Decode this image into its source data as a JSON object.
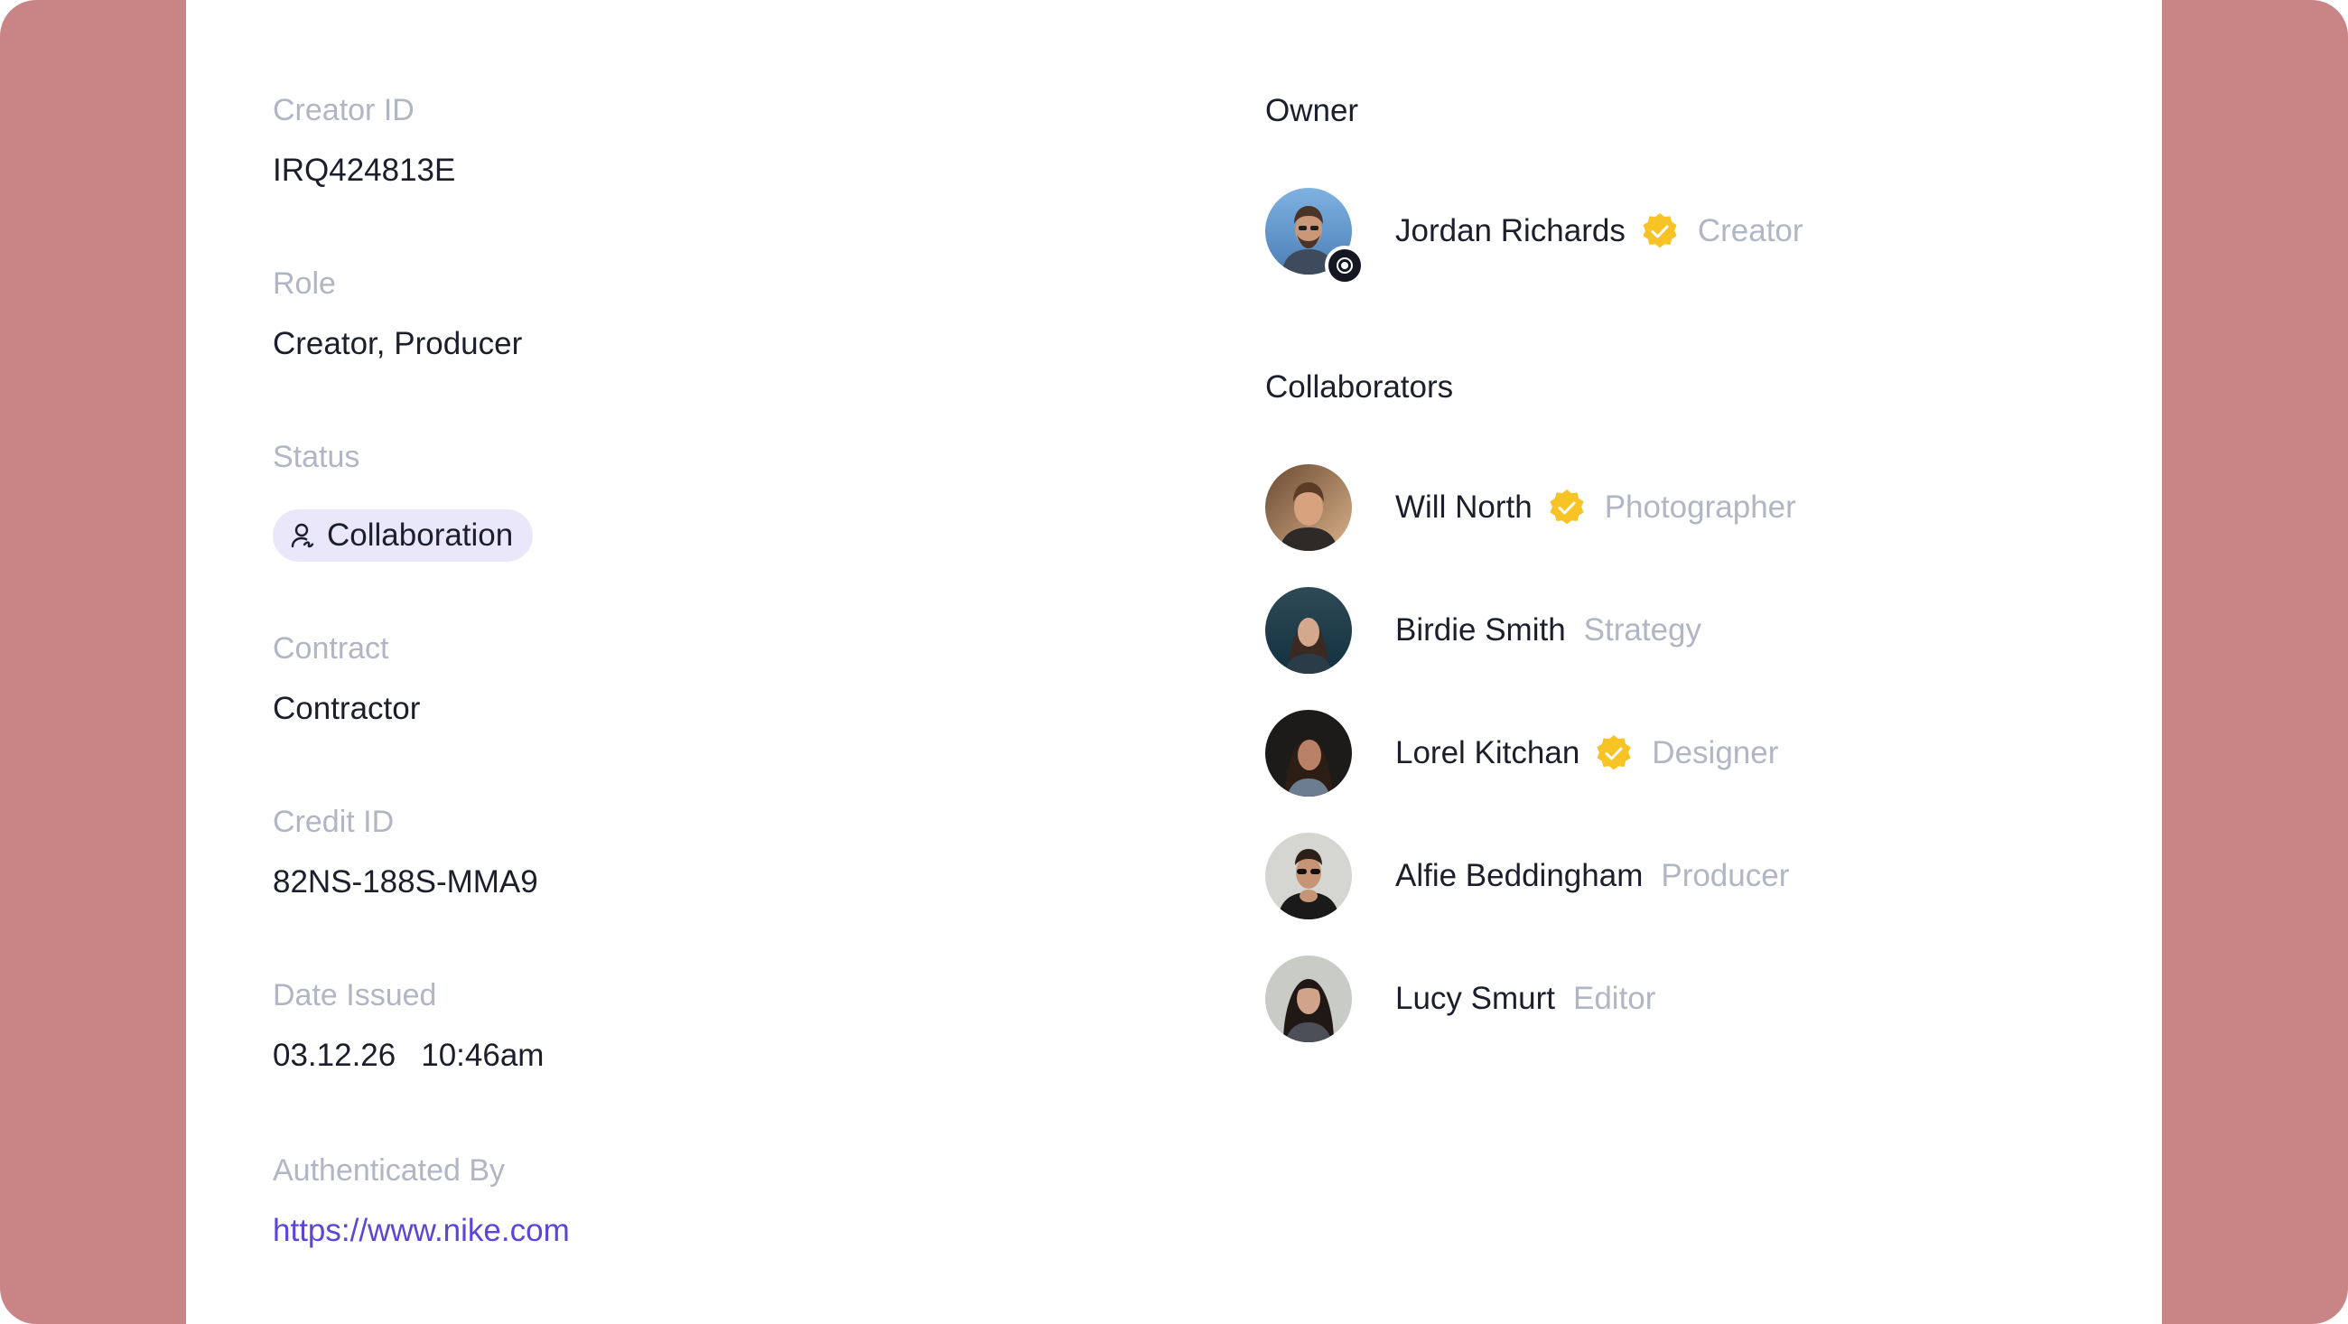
{
  "details": {
    "creator_id_label": "Creator ID",
    "creator_id_value": "IRQ424813E",
    "role_label": "Role",
    "role_value": "Creator, Producer",
    "status_label": "Status",
    "status_value": "Collaboration",
    "status_icon": "user-collab-icon",
    "contract_label": "Contract",
    "contract_value": "Contractor",
    "credit_id_label": "Credit ID",
    "credit_id_value": "82NS-188S-MMA9",
    "date_issued_label": "Date Issued",
    "date_value": "03.12.26",
    "time_value": "10:46am",
    "authenticated_by_label": "Authenticated By",
    "authenticated_by_value": "https://www.nike.com"
  },
  "owner": {
    "heading": "Owner",
    "name": "Jordan Richards",
    "role": "Creator",
    "verified": true,
    "badge_icon": "eye-icon"
  },
  "collaborators": {
    "heading": "Collaborators",
    "people": [
      {
        "name": "Will North",
        "role": "Photographer",
        "verified": true
      },
      {
        "name": "Birdie Smith",
        "role": "Strategy",
        "verified": false
      },
      {
        "name": "Lorel Kitchan",
        "role": "Designer",
        "verified": true
      },
      {
        "name": "Alfie Beddingham",
        "role": "Producer",
        "verified": false
      },
      {
        "name": "Lucy Smurt",
        "role": "Editor",
        "verified": false
      }
    ]
  },
  "colors": {
    "frame_background": "#c98585",
    "label_gray": "#b1b5c4",
    "text_dark": "#1c1f2b",
    "link_purple": "#5b46d6",
    "chip_background": "#ebe7fb",
    "verified_yellow": "#f7c325"
  }
}
